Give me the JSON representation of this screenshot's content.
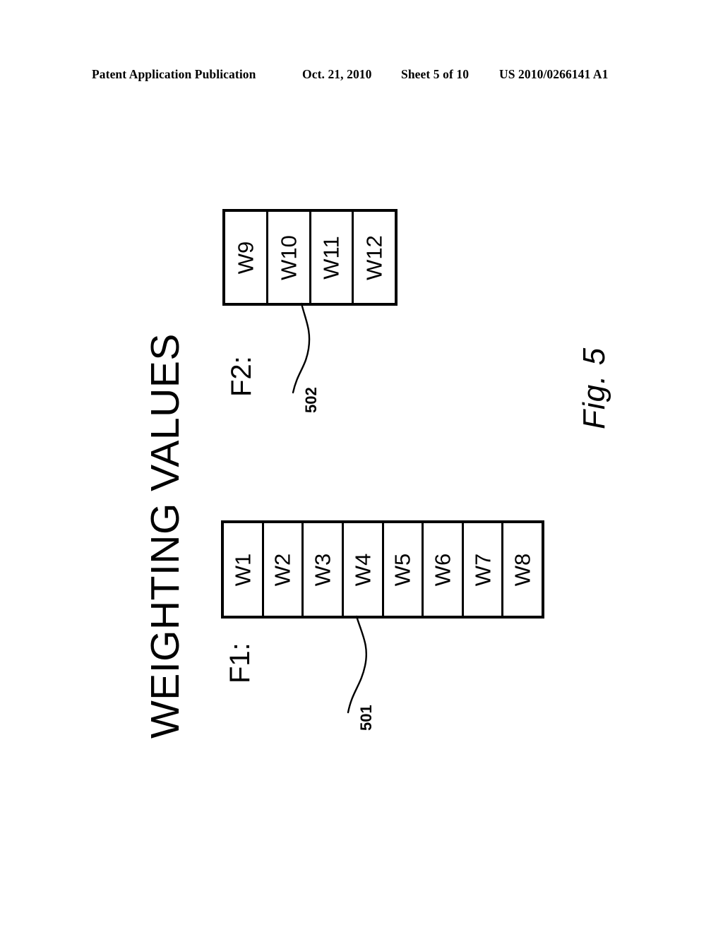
{
  "header": {
    "publication": "Patent Application Publication",
    "date": "Oct. 21, 2010",
    "sheet": "Sheet 5 of 10",
    "patent_number": "US 2010/0266141 A1"
  },
  "figure": {
    "number": "Fig. 5",
    "title": "WEIGHTING VALUES",
    "arrays": [
      {
        "name": "F2:",
        "reference": "502",
        "cells": [
          "W9",
          "W10",
          "W11",
          "W12"
        ]
      },
      {
        "name": "F1:",
        "reference": "501",
        "cells": [
          "W1",
          "W2",
          "W3",
          "W4",
          "W5",
          "W6",
          "W7",
          "W8"
        ]
      }
    ]
  },
  "style": {
    "ink": "#000000",
    "paper": "#ffffff"
  }
}
